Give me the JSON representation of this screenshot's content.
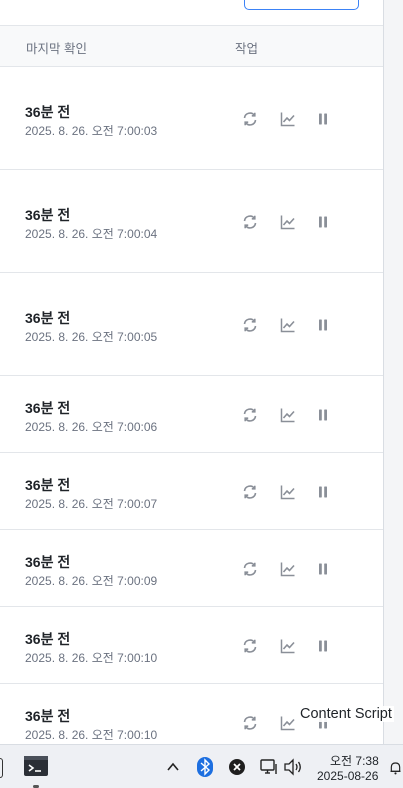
{
  "table": {
    "headers": {
      "last_checked": "마지막 확인",
      "actions": "작업"
    },
    "rows": [
      {
        "relative": "36분 전",
        "timestamp": "2025. 8. 26. 오전 7:00:03"
      },
      {
        "relative": "36분 전",
        "timestamp": "2025. 8. 26. 오전 7:00:04"
      },
      {
        "relative": "36분 전",
        "timestamp": "2025. 8. 26. 오전 7:00:05"
      },
      {
        "relative": "36분 전",
        "timestamp": "2025. 8. 26. 오전 7:00:06"
      },
      {
        "relative": "36분 전",
        "timestamp": "2025. 8. 26. 오전 7:00:07"
      },
      {
        "relative": "36분 전",
        "timestamp": "2025. 8. 26. 오전 7:00:09"
      },
      {
        "relative": "36분 전",
        "timestamp": "2025. 8. 26. 오전 7:00:10"
      },
      {
        "relative": "36분 전",
        "timestamp": "2025. 8. 26. 오전 7:00:10"
      }
    ],
    "row_actions": [
      "refresh-icon",
      "chart-icon",
      "pause-icon"
    ]
  },
  "tooltip": {
    "text": "Content Script"
  },
  "taskbar": {
    "clock_time": "오전 7:38",
    "clock_date": "2025-08-26",
    "icons": [
      "terminal-icon",
      "chevron-up-icon",
      "bluetooth-icon",
      "close-circle-icon",
      "network-icon",
      "volume-icon",
      "notification-icon"
    ]
  },
  "colors": {
    "icon_gray": "#8a8f98",
    "border": "#e3e6ea",
    "accent": "#3b82f6",
    "bluetooth": "#1d6fe0"
  }
}
